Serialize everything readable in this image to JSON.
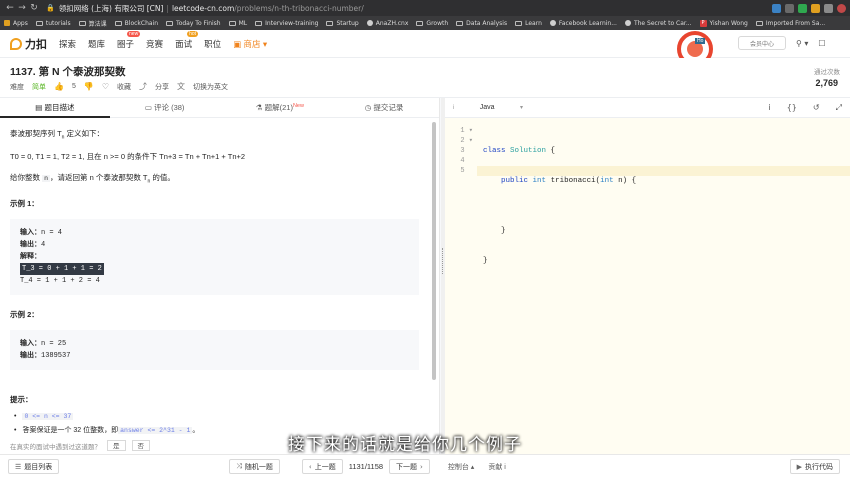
{
  "browser": {
    "url_domain": "领扣网络 (上海) 有限公司 [CN]",
    "url_host": "leetcode-cn.com",
    "url_path": "/problems/n-th-tribonacci-number/",
    "bookmarks": [
      "Apps",
      "tutorials",
      "算法课",
      "BlockChain",
      "Today To Finish",
      "ML",
      "Interview-training",
      "Startup",
      "AnaZH.cnx",
      "Growth",
      "Data Analysis",
      "Learn",
      "Facebook Learnin...",
      "The Secret to Car...",
      "Yishan Wong",
      "Imported From Sa..."
    ]
  },
  "header": {
    "logo": "力扣",
    "nav": [
      "探索",
      "题库",
      "圈子",
      "竞赛",
      "面试",
      "职位",
      "商店"
    ],
    "new_badge": "new",
    "hot_badge": "hot",
    "pill": "会员中心",
    "avatar_tag": "Ho"
  },
  "problem": {
    "title": "1137. 第 N 个泰波那契数",
    "difficulty_label": "难度",
    "difficulty": "简单",
    "likes": "5",
    "favorite": "收藏",
    "share": "分享",
    "switch_lang": "切换为英文",
    "submit_label": "通过次数",
    "submit_count": "2,769"
  },
  "tabs": {
    "desc": "题目描述",
    "comments": "评论 (38)",
    "solutions": "题解(21)",
    "solutions_new": "New",
    "submissions": "提交记录"
  },
  "content": {
    "intro": "泰波那契序列 T",
    "intro_sub": "n",
    "intro_tail": " 定义如下：",
    "formula": "T",
    "formula_full": "T0 = 0, T1 = 1, T2 = 1, 且在 n >= 0 的条件下 Tn+3 = Tn + Tn+1 + Tn+2",
    "task_pre": "给你整数 ",
    "task_code": "n",
    "task_post": "，请返回第 n 个泰波那契数 T",
    "task_sub": "n",
    "task_end": " 的值。",
    "ex1_title": "示例 1：",
    "ex1_input_label": "输入：",
    "ex1_input": "n = 4",
    "ex1_output_label": "输出：",
    "ex1_output": "4",
    "ex1_explain_label": "解释：",
    "ex1_line1": "T_3 = 0 + 1 + 1 = 2",
    "ex1_line2": "T_4 = 1 + 1 + 2 = 4",
    "ex2_title": "示例 2：",
    "ex2_input_label": "输入：",
    "ex2_input": "n = 25",
    "ex2_output_label": "输出：",
    "ex2_output": "1389537",
    "hint_title": "提示：",
    "hint1": "0 <= n <= 37",
    "hint2_pre": "答案保证是一个 32 位整数，即 ",
    "hint2_code": "answer <= 2^31 - 1",
    "hint2_post": "。",
    "feedback": "在真实的面试中遇到过这道题？",
    "yes": "是",
    "no": "否"
  },
  "editor": {
    "language": "Java",
    "line_numbers": [
      "1",
      "2",
      "3",
      "4",
      "5"
    ],
    "code": {
      "l1_kw": "class",
      "l1_cls": "Solution",
      "l1_end": " {",
      "l2_kw1": "public",
      "l2_typ": "int",
      "l2_mid": " tribonacci(",
      "l2_typ2": "int",
      "l2_end": " n) {",
      "l3": "",
      "l4": "    }",
      "l5": "}"
    }
  },
  "subtitle": "接下来的话就是给你几个例子",
  "bottom": {
    "problem_list": "题目列表",
    "random": "随机一题",
    "prev": "上一题",
    "page": "1131/1158",
    "next": "下一题",
    "console": "控制台",
    "contribute": "贡献 i",
    "run": "执行代码"
  }
}
